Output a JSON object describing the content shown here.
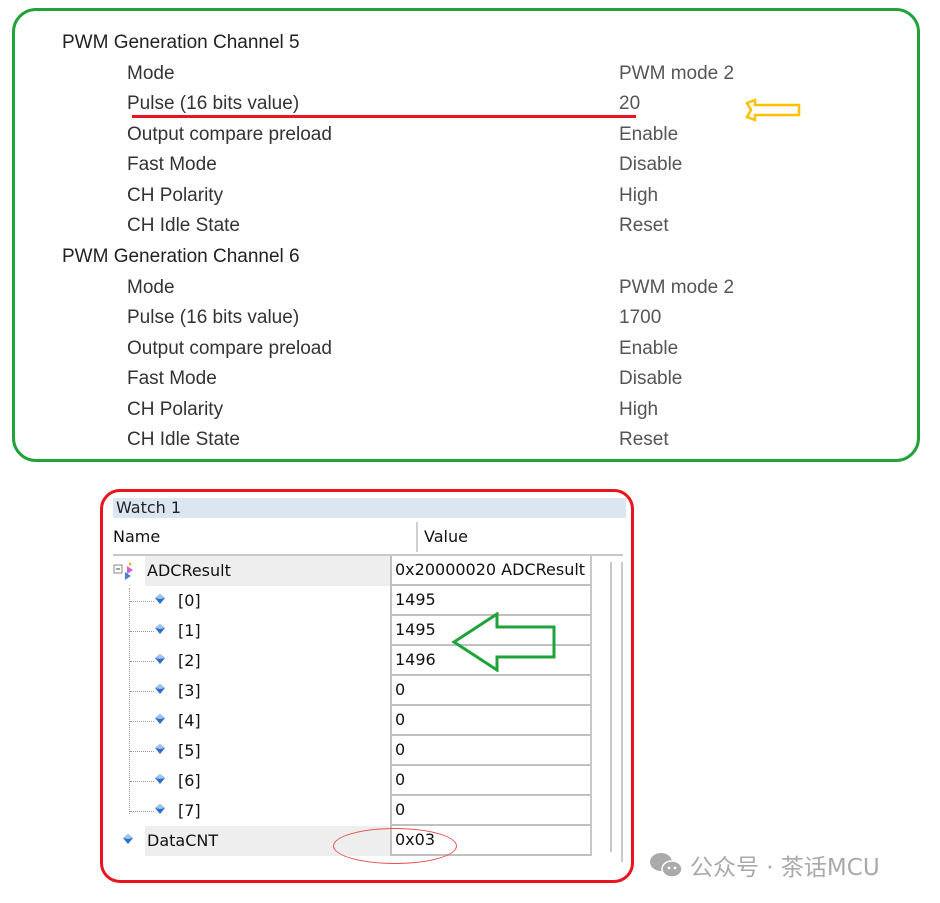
{
  "config": {
    "channels": [
      {
        "title": "PWM Generation Channel 5",
        "params": [
          {
            "label": "Mode",
            "value": "PWM mode 2"
          },
          {
            "label": "Pulse (16 bits value)",
            "value": "20"
          },
          {
            "label": "Output compare preload",
            "value": "Enable"
          },
          {
            "label": "Fast Mode",
            "value": "Disable"
          },
          {
            "label": "CH Polarity",
            "value": "High"
          },
          {
            "label": "CH Idle State",
            "value": "Reset"
          }
        ]
      },
      {
        "title": "PWM Generation Channel 6",
        "params": [
          {
            "label": "Mode",
            "value": "PWM mode 2"
          },
          {
            "label": "Pulse (16 bits value)",
            "value": "1700"
          },
          {
            "label": "Output compare preload",
            "value": "Enable"
          },
          {
            "label": "Fast Mode",
            "value": "Disable"
          },
          {
            "label": "CH Polarity",
            "value": "High"
          },
          {
            "label": "CH Idle State",
            "value": "Reset"
          }
        ]
      }
    ]
  },
  "watch": {
    "title": "Watch 1",
    "columns": {
      "name": "Name",
      "value": "Value"
    },
    "rows": [
      {
        "name": "ADCResult",
        "value": "0x20000020 ADCResult",
        "icon": "struct-expand-icon",
        "level": 0
      },
      {
        "name": "[0]",
        "value": "1495",
        "icon": "variable-gem-icon",
        "level": 1
      },
      {
        "name": "[1]",
        "value": "1495",
        "icon": "variable-gem-icon",
        "level": 1
      },
      {
        "name": "[2]",
        "value": "1496",
        "icon": "variable-gem-icon",
        "level": 1
      },
      {
        "name": "[3]",
        "value": "0",
        "icon": "variable-gem-icon",
        "level": 1
      },
      {
        "name": "[4]",
        "value": "0",
        "icon": "variable-gem-icon",
        "level": 1
      },
      {
        "name": "[5]",
        "value": "0",
        "icon": "variable-gem-icon",
        "level": 1
      },
      {
        "name": "[6]",
        "value": "0",
        "icon": "variable-gem-icon",
        "level": 1
      },
      {
        "name": "[7]",
        "value": "0",
        "icon": "variable-gem-icon",
        "level": 1
      },
      {
        "name": "DataCNT",
        "value": "0x03",
        "icon": "variable-gem-icon",
        "level": 0
      }
    ]
  },
  "annotations": {
    "green_frame_color": "#1fa33a",
    "red_frame_color": "#e8141e",
    "highlight_arrow_color": "#ffc000"
  },
  "watermark": {
    "text": "公众号 · 茶话MCU"
  }
}
